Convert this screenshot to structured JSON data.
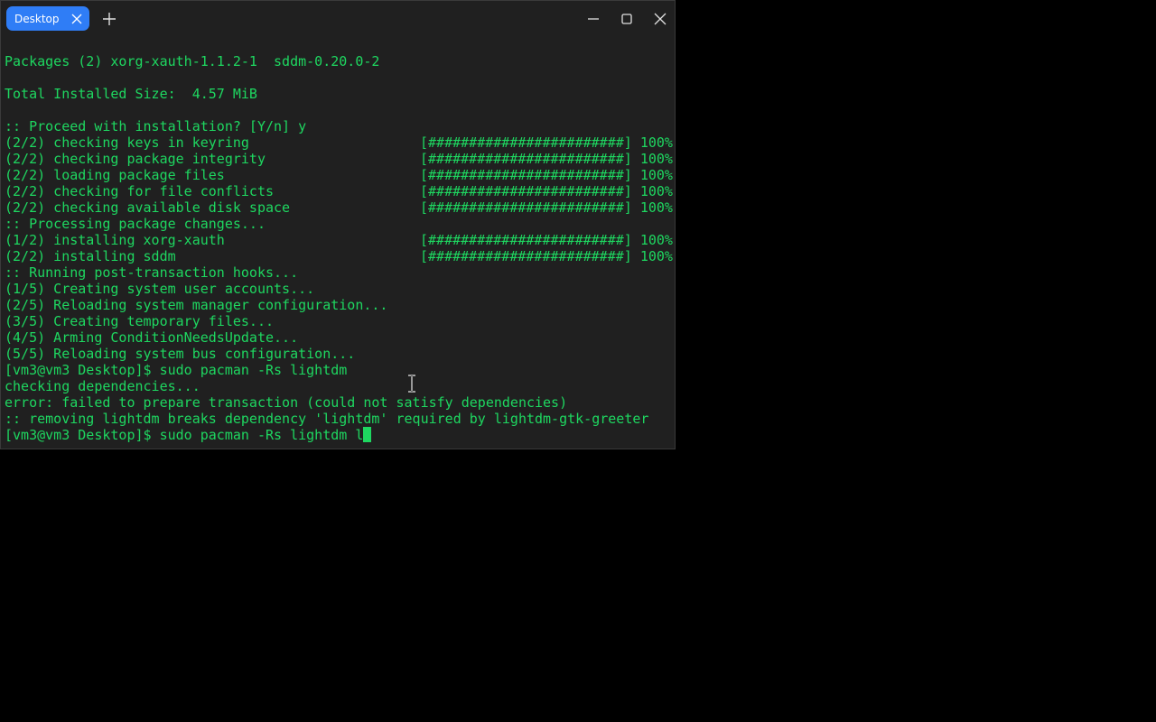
{
  "window": {
    "tab_label": "Desktop",
    "tab_close_icon": "close-icon",
    "new_tab_icon": "plus-icon",
    "controls": [
      "minimize-icon",
      "maximize-icon",
      "close-icon"
    ]
  },
  "colors": {
    "terminal_text": "#1ed760",
    "terminal_bg": "#202020",
    "tab_accent": "#2f7df6",
    "desktop_bg": "#000000"
  },
  "terminal": {
    "lines": [
      {
        "text": ""
      },
      {
        "text": "Packages (2) xorg-xauth-1.1.2-1  sddm-0.20.0-2"
      },
      {
        "text": ""
      },
      {
        "text": "Total Installed Size:  4.57 MiB"
      },
      {
        "text": ""
      },
      {
        "text": ":: Proceed with installation? [Y/n] y"
      },
      {
        "text": "(2/2) checking keys in keyring",
        "progress": "[########################] 100%"
      },
      {
        "text": "(2/2) checking package integrity",
        "progress": "[########################] 100%"
      },
      {
        "text": "(2/2) loading package files",
        "progress": "[########################] 100%"
      },
      {
        "text": "(2/2) checking for file conflicts",
        "progress": "[########################] 100%"
      },
      {
        "text": "(2/2) checking available disk space",
        "progress": "[########################] 100%"
      },
      {
        "text": ":: Processing package changes..."
      },
      {
        "text": "(1/2) installing xorg-xauth",
        "progress": "[########################] 100%"
      },
      {
        "text": "(2/2) installing sddm",
        "progress": "[########################] 100%"
      },
      {
        "text": ":: Running post-transaction hooks..."
      },
      {
        "text": "(1/5) Creating system user accounts..."
      },
      {
        "text": "(2/5) Reloading system manager configuration..."
      },
      {
        "text": "(3/5) Creating temporary files..."
      },
      {
        "text": "(4/5) Arming ConditionNeedsUpdate..."
      },
      {
        "text": "(5/5) Reloading system bus configuration..."
      },
      {
        "text": "[vm3@vm3 Desktop]$ sudo pacman -Rs lightdm"
      },
      {
        "text": "checking dependencies..."
      },
      {
        "text": "error: failed to prepare transaction (could not satisfy dependencies)"
      },
      {
        "text": ":: removing lightdm breaks dependency 'lightdm' required by lightdm-gtk-greeter"
      }
    ],
    "prompt": "[vm3@vm3 Desktop]$ ",
    "current_input": "sudo pacman -Rs lightdm l"
  }
}
